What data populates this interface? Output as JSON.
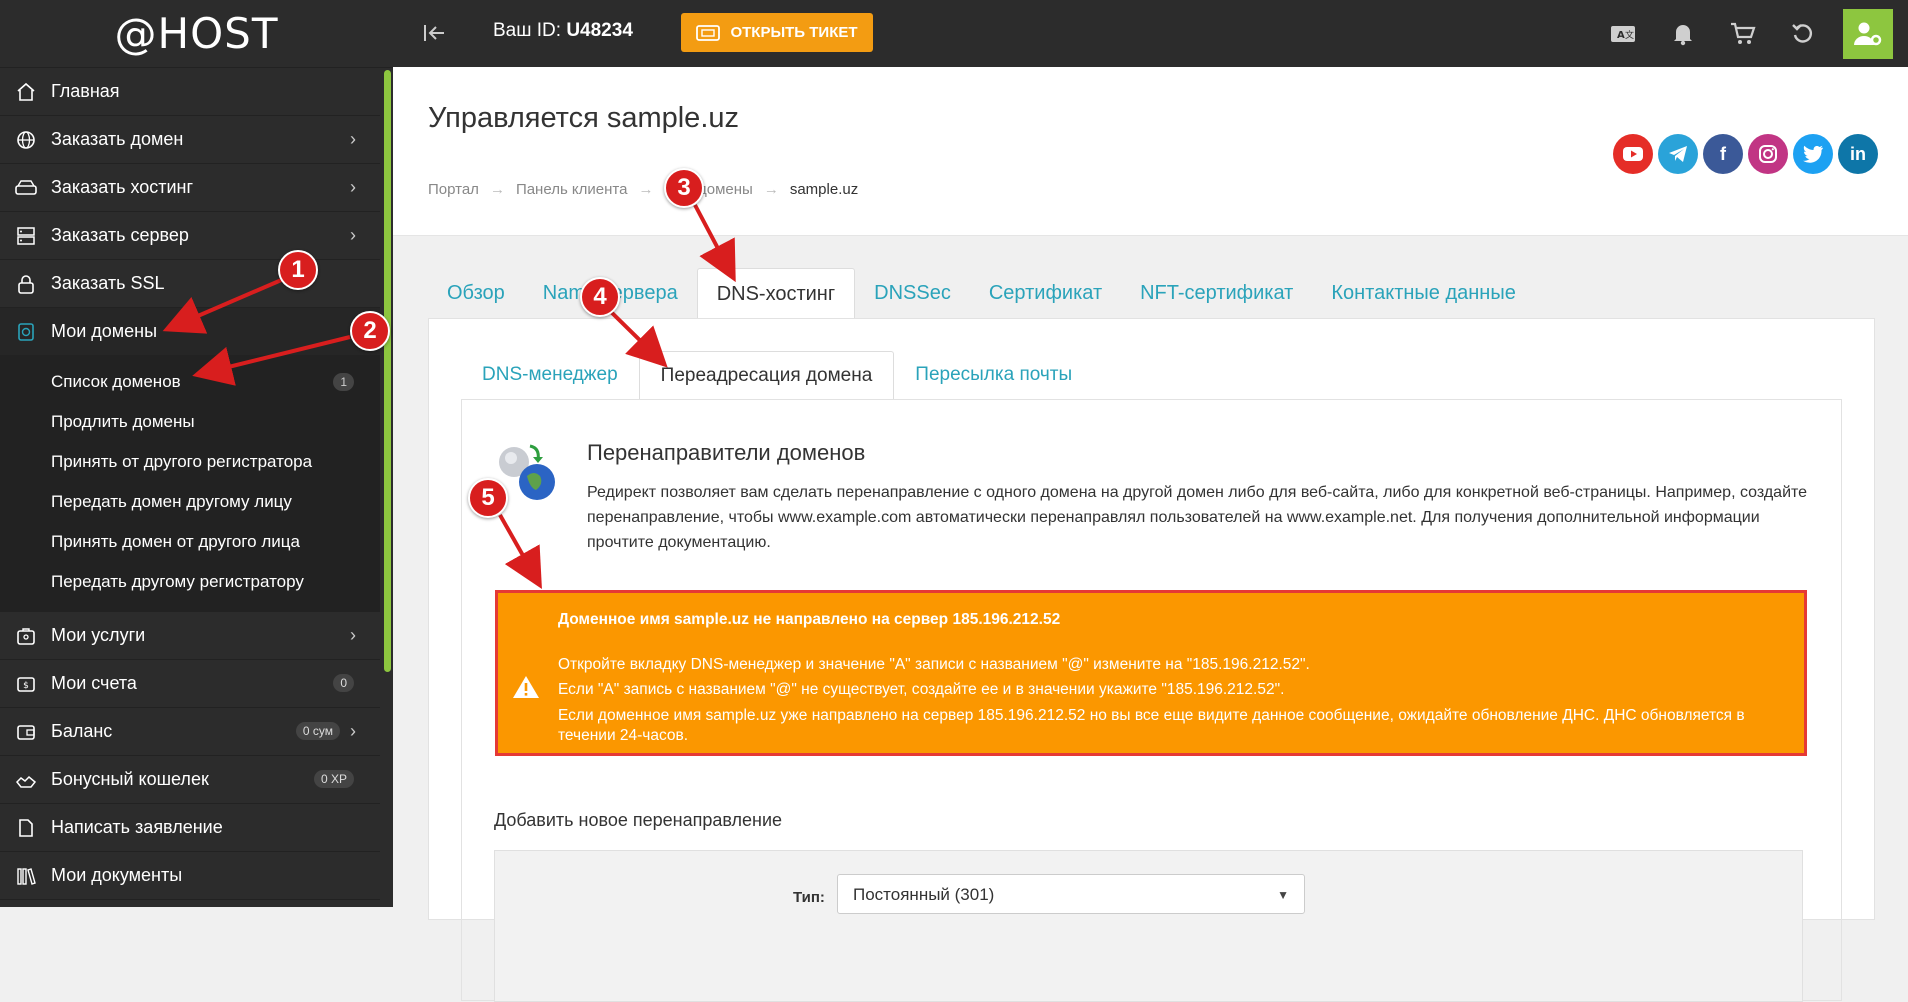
{
  "logo": "@HOST",
  "sidebar": {
    "items": [
      {
        "label": "Главная",
        "icon": "home-icon",
        "chevron": false
      },
      {
        "label": "Заказать домен",
        "icon": "globe-icon",
        "chevron": true
      },
      {
        "label": "Заказать хостинг",
        "icon": "hdd-icon",
        "chevron": true
      },
      {
        "label": "Заказать сервер",
        "icon": "server-icon",
        "chevron": true
      },
      {
        "label": "Заказать SSL",
        "icon": "lock-icon",
        "chevron": false
      },
      {
        "label": "Мои домены",
        "icon": "domain-icon",
        "chevron": false
      }
    ],
    "submenu": [
      {
        "label": "Список доменов",
        "badge": "1"
      },
      {
        "label": "Продлить домены"
      },
      {
        "label": "Принять от другого регистратора"
      },
      {
        "label": "Передать домен другому лицу"
      },
      {
        "label": "Принять домен от другого лица"
      },
      {
        "label": "Передать другому регистратору"
      }
    ],
    "items2": [
      {
        "label": "Мои услуги",
        "icon": "services-icon",
        "chevron": true
      },
      {
        "label": "Мои счета",
        "icon": "invoice-icon",
        "badge": "0"
      },
      {
        "label": "Баланс",
        "icon": "wallet-icon",
        "badge": "0 сум",
        "chevron": true
      },
      {
        "label": "Бонусный кошелек",
        "icon": "bonus-icon",
        "badge": "0 XP"
      },
      {
        "label": "Написать заявление",
        "icon": "document-icon"
      },
      {
        "label": "Мои документы",
        "icon": "books-icon"
      }
    ]
  },
  "topbar": {
    "id_label": "Ваш ID:",
    "id_value": "U48234",
    "ticket_label": "ОТКРЫТЬ ТИКЕТ"
  },
  "header": {
    "title": "Управляется sample.uz",
    "breadcrumb": [
      "Портал",
      "Панель клиента",
      "Мои домены",
      "sample.uz"
    ]
  },
  "tabs": [
    "Обзор",
    "Name сервера",
    "DNS-хостинг",
    "DNSSec",
    "Сертификат",
    "NFT-сертификат",
    "Контактные данные"
  ],
  "subtabs": [
    "DNS-менеджер",
    "Переадресация домена",
    "Пересылка почты"
  ],
  "section": {
    "title": "Перенаправители доменов",
    "description": "Редирект позволяет вам сделать перенаправление с одного домена на другой домен либо для веб-сайта, либо для конкретной веб-страницы. Например, создайте перенаправление, чтобы www.example.com автоматически перенаправлял пользователей на www.example.net. Для получения дополнительной информации прочтите документацию."
  },
  "alert": {
    "title": "Доменное имя sample.uz не направлено на сервер 185.196.212.52",
    "line1": "Откройте вкладку DNS-менеджер и значение \"A\" записи с названием \"@\" измените на \"185.196.212.52\".",
    "line2": "Если \"A\" запись с названием \"@\" не существует, создайте ее и в значении укажите \"185.196.212.52\".",
    "line3": "Если доменное имя sample.uz уже направлено на сервер 185.196.212.52 но вы все еще видите данное сообщение, ожидайте обновление ДНС. ДНС обновляется в течении 24-часов."
  },
  "form": {
    "add_title": "Добавить новое перенаправление",
    "type_label": "Тип:",
    "type_value": "Постоянный (301)"
  },
  "markers": [
    "1",
    "2",
    "3",
    "4",
    "5"
  ],
  "colors": {
    "accent": "#2aa3ba",
    "brand_green": "#8dc63f",
    "ticket": "#f39c12",
    "alert_bg": "#fb9700",
    "alert_border": "#e53935",
    "marker": "#d81e1e"
  }
}
